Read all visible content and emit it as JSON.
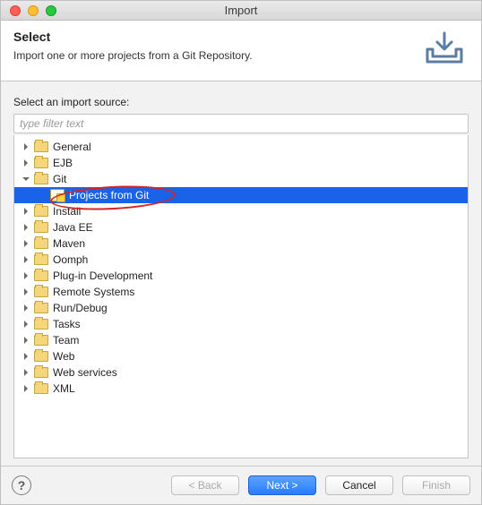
{
  "window": {
    "title": "Import"
  },
  "header": {
    "title": "Select",
    "subtitle": "Import one or more projects from a Git Repository."
  },
  "filter": {
    "label": "Select an import source:",
    "placeholder": "type filter text"
  },
  "tree": [
    {
      "label": "General",
      "depth": 0,
      "expanded": false,
      "icon": "folder"
    },
    {
      "label": "EJB",
      "depth": 0,
      "expanded": false,
      "icon": "folder"
    },
    {
      "label": "Git",
      "depth": 0,
      "expanded": true,
      "icon": "folder"
    },
    {
      "label": "Projects from Git",
      "depth": 1,
      "expanded": null,
      "icon": "wizard",
      "selected": true
    },
    {
      "label": "Install",
      "depth": 0,
      "expanded": false,
      "icon": "folder"
    },
    {
      "label": "Java EE",
      "depth": 0,
      "expanded": false,
      "icon": "folder"
    },
    {
      "label": "Maven",
      "depth": 0,
      "expanded": false,
      "icon": "folder"
    },
    {
      "label": "Oomph",
      "depth": 0,
      "expanded": false,
      "icon": "folder"
    },
    {
      "label": "Plug-in Development",
      "depth": 0,
      "expanded": false,
      "icon": "folder"
    },
    {
      "label": "Remote Systems",
      "depth": 0,
      "expanded": false,
      "icon": "folder"
    },
    {
      "label": "Run/Debug",
      "depth": 0,
      "expanded": false,
      "icon": "folder"
    },
    {
      "label": "Tasks",
      "depth": 0,
      "expanded": false,
      "icon": "folder"
    },
    {
      "label": "Team",
      "depth": 0,
      "expanded": false,
      "icon": "folder"
    },
    {
      "label": "Web",
      "depth": 0,
      "expanded": false,
      "icon": "folder"
    },
    {
      "label": "Web services",
      "depth": 0,
      "expanded": false,
      "icon": "folder"
    },
    {
      "label": "XML",
      "depth": 0,
      "expanded": false,
      "icon": "folder"
    }
  ],
  "buttons": {
    "back": {
      "label": "< Back",
      "enabled": false
    },
    "next": {
      "label": "Next >",
      "enabled": true,
      "primary": true
    },
    "cancel": {
      "label": "Cancel",
      "enabled": true
    },
    "finish": {
      "label": "Finish",
      "enabled": false
    }
  }
}
